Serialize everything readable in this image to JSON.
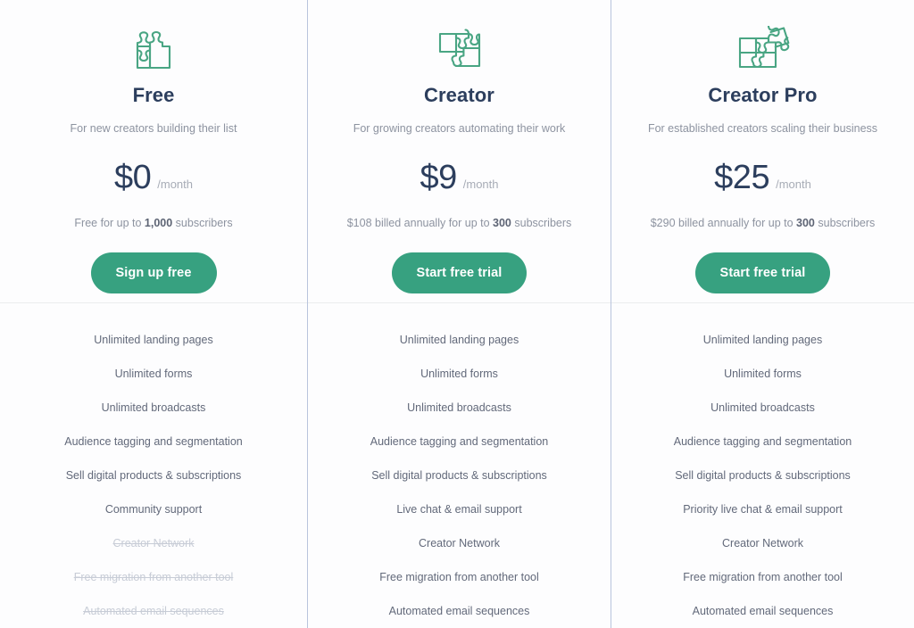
{
  "theme": {
    "accent_green": "#37a180",
    "heading_navy": "#2c3e5d",
    "muted_text": "#8d93a0",
    "feature_text": "#62697a",
    "excluded_text": "#c7ccd6",
    "column_divider": "#b9c4dd",
    "row_divider": "#ebecee"
  },
  "plans": [
    {
      "icon": "puzzle-two-pieces-icon",
      "name": "Free",
      "tagline": "For new creators building their list",
      "price": "$0",
      "period": "/month",
      "billing_prefix": "Free for up to ",
      "billing_emphasis": "1,000",
      "billing_suffix": " subscribers",
      "cta_label": "Sign up free",
      "features": [
        {
          "label": "Unlimited landing pages",
          "included": true
        },
        {
          "label": "Unlimited forms",
          "included": true
        },
        {
          "label": "Unlimited broadcasts",
          "included": true
        },
        {
          "label": "Audience tagging and segmentation",
          "included": true
        },
        {
          "label": "Sell digital products & subscriptions",
          "included": true
        },
        {
          "label": "Community support",
          "included": true
        },
        {
          "label": "Creator Network",
          "included": false
        },
        {
          "label": "Free migration from another tool",
          "included": false
        },
        {
          "label": "Automated email sequences",
          "included": false
        }
      ]
    },
    {
      "icon": "puzzle-three-pieces-icon",
      "name": "Creator",
      "tagline": "For growing creators automating their work",
      "price": "$9",
      "period": "/month",
      "billing_prefix": "$108 billed annually for up to ",
      "billing_emphasis": "300",
      "billing_suffix": " subscribers",
      "cta_label": "Start free trial",
      "features": [
        {
          "label": "Unlimited landing pages",
          "included": true
        },
        {
          "label": "Unlimited forms",
          "included": true
        },
        {
          "label": "Unlimited broadcasts",
          "included": true
        },
        {
          "label": "Audience tagging and segmentation",
          "included": true
        },
        {
          "label": "Sell digital products & subscriptions",
          "included": true
        },
        {
          "label": "Live chat & email support",
          "included": true
        },
        {
          "label": "Creator Network",
          "included": true
        },
        {
          "label": "Free migration from another tool",
          "included": true
        },
        {
          "label": "Automated email sequences",
          "included": true
        }
      ]
    },
    {
      "icon": "puzzle-four-pieces-icon",
      "name": "Creator Pro",
      "tagline": "For established creators scaling their business",
      "price": "$25",
      "period": "/month",
      "billing_prefix": "$290 billed annually for up to ",
      "billing_emphasis": "300",
      "billing_suffix": " subscribers",
      "cta_label": "Start free trial",
      "features": [
        {
          "label": "Unlimited landing pages",
          "included": true
        },
        {
          "label": "Unlimited forms",
          "included": true
        },
        {
          "label": "Unlimited broadcasts",
          "included": true
        },
        {
          "label": "Audience tagging and segmentation",
          "included": true
        },
        {
          "label": "Sell digital products & subscriptions",
          "included": true
        },
        {
          "label": "Priority live chat & email support",
          "included": true
        },
        {
          "label": "Creator Network",
          "included": true
        },
        {
          "label": "Free migration from another tool",
          "included": true
        },
        {
          "label": "Automated email sequences",
          "included": true
        }
      ]
    }
  ]
}
